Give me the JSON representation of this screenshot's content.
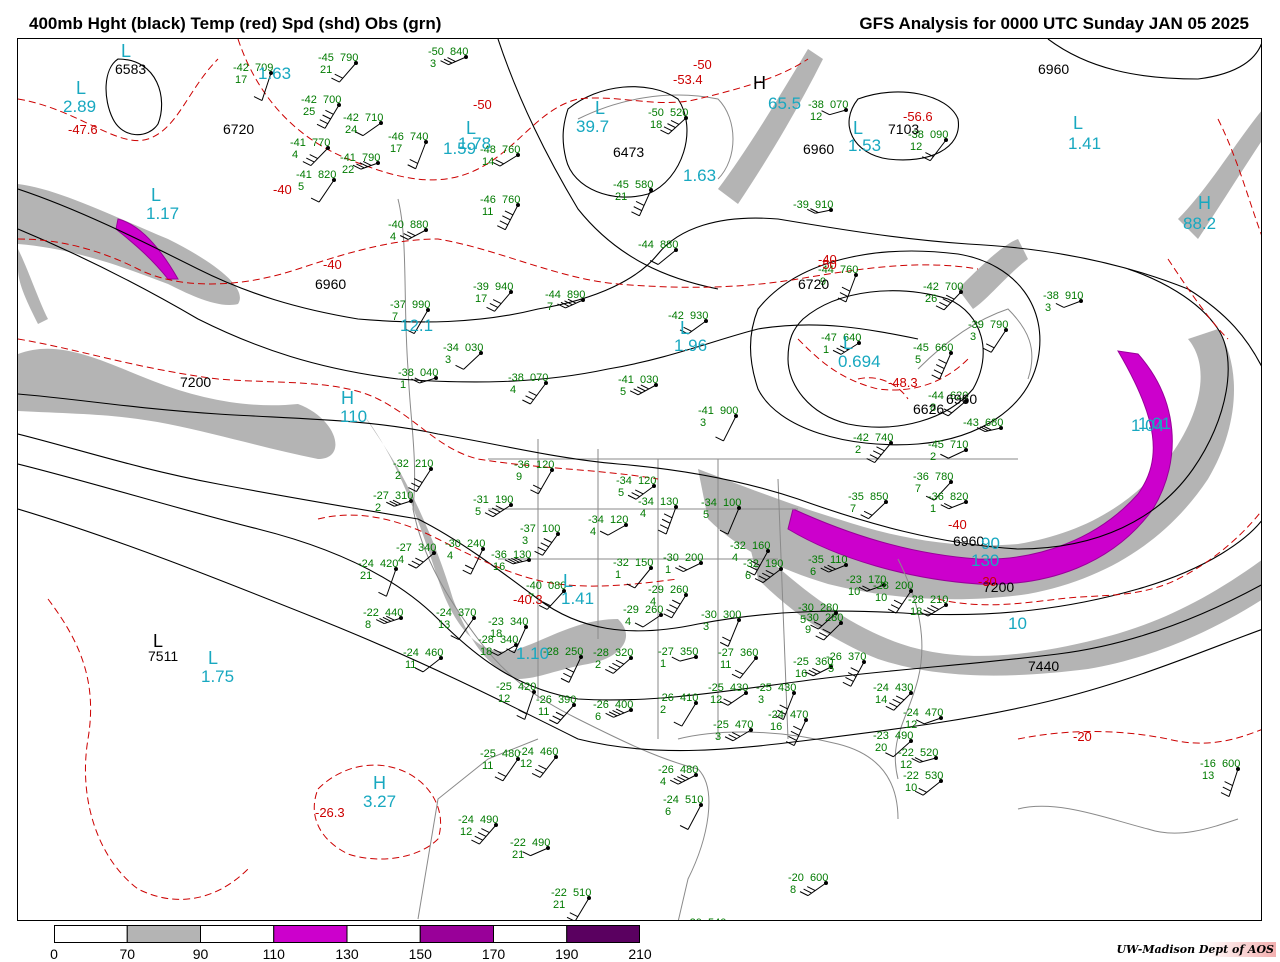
{
  "header": {
    "title_left": "400mb Hght (black) Temp (red) Spd (shd) Obs (grn)",
    "title_right": "GFS Analysis for 0000 UTC Sunday  JAN 05 2025"
  },
  "credit": "UW-Madison  Dept of AOS",
  "colors": {
    "height": "#000000",
    "temp": "#cc0000",
    "obs": "#007a00",
    "speed_label": "#18a8c0",
    "borders": "#8a8a8a"
  },
  "legend": {
    "ticks": [
      "0",
      "70",
      "90",
      "110",
      "130",
      "150",
      "170",
      "190",
      "210"
    ],
    "bins": [
      {
        "from": 0,
        "to": 70,
        "color": "#ffffff"
      },
      {
        "from": 70,
        "to": 90,
        "color": "#b4b4b4"
      },
      {
        "from": 90,
        "to": 110,
        "color": "#ffffff"
      },
      {
        "from": 110,
        "to": 130,
        "color": "#cc00cc"
      },
      {
        "from": 130,
        "to": 150,
        "color": "#ffffff"
      },
      {
        "from": 150,
        "to": 170,
        "color": "#990099"
      },
      {
        "from": 170,
        "to": 190,
        "color": "#ffffff"
      },
      {
        "from": 190,
        "to": 210,
        "color": "#5a0060"
      }
    ]
  },
  "height_labels": [
    "6583",
    "6720",
    "6960",
    "6473",
    "6960",
    "6960",
    "6720",
    "6960",
    "7103",
    "7200",
    "6626",
    "6960",
    "7200",
    "7440",
    "7511"
  ],
  "temp_labels": [
    "-47.6",
    "-50",
    "-50",
    "-53.4",
    "-40",
    "-40",
    "-50",
    "-56.6",
    "-40",
    "-48.3",
    "-40",
    "-40.3",
    "-30",
    "-20",
    "-26.3"
  ],
  "speed_labels": [
    "2.89",
    "1.63",
    "1.17",
    "39.7",
    "1.78",
    "65.5",
    "1.53",
    "1.41",
    "88.2",
    "1.96",
    "0.694",
    "110",
    "1.41",
    "1.75",
    "3.27",
    "1.10",
    "10",
    "130",
    "1.63",
    "90",
    "1.01",
    "12.1",
    "1.59",
    "1.04"
  ],
  "highs_lows": [
    "L",
    "L",
    "L",
    "L",
    "L",
    "H",
    "L",
    "L",
    "H",
    "L",
    "L",
    "H",
    "L",
    "L",
    "H",
    "L"
  ],
  "obs": [
    [
      "-42",
      "709",
      "17"
    ],
    [
      "-45",
      "790",
      "21"
    ],
    [
      "-50",
      "840",
      "3"
    ],
    [
      "-42",
      "700",
      "25"
    ],
    [
      "-42",
      "710",
      "24"
    ],
    [
      "-46",
      "740",
      "17"
    ],
    [
      "-41",
      "770",
      "4"
    ],
    [
      "-41",
      "790",
      "22"
    ],
    [
      "-41",
      "820",
      "5"
    ],
    [
      "-48",
      "760",
      "14"
    ],
    [
      "-45",
      "580",
      "21"
    ],
    [
      "-50",
      "520",
      "18"
    ],
    [
      "-38",
      "070",
      "12"
    ],
    [
      "-38",
      "090",
      "12"
    ],
    [
      "-40",
      "880",
      "4"
    ],
    [
      "-46",
      "760",
      "11"
    ],
    [
      "-44",
      "880",
      ""
    ],
    [
      "-39",
      "910",
      ""
    ],
    [
      "-39",
      "940",
      "17"
    ],
    [
      "-44",
      "890",
      "7"
    ],
    [
      "-37",
      "990",
      "7"
    ],
    [
      "-42",
      "930",
      ""
    ],
    [
      "-44",
      "760",
      "9"
    ],
    [
      "-42",
      "700",
      "26"
    ],
    [
      "-38",
      "910",
      "3"
    ],
    [
      "-39",
      "790",
      "3"
    ],
    [
      "-47",
      "640",
      "1"
    ],
    [
      "-45",
      "660",
      "5"
    ],
    [
      "-34",
      "030",
      "3"
    ],
    [
      "-38",
      "040",
      "1"
    ],
    [
      "-38",
      "070",
      "4"
    ],
    [
      "-41",
      "030",
      "5"
    ],
    [
      "-41",
      "900",
      "3"
    ],
    [
      "-44",
      "620",
      "8"
    ],
    [
      "-43",
      "680",
      ""
    ],
    [
      "-42",
      "740",
      "2"
    ],
    [
      "-45",
      "710",
      "2"
    ],
    [
      "-36",
      "120",
      "9"
    ],
    [
      "-34",
      "120",
      "5"
    ],
    [
      "-34",
      "130",
      "4"
    ],
    [
      "-36",
      "780",
      "7"
    ],
    [
      "-36",
      "820",
      "1"
    ],
    [
      "-32",
      "210",
      "2"
    ],
    [
      "-31",
      "190",
      "5"
    ],
    [
      "-34",
      "100",
      "5"
    ],
    [
      "-35",
      "850",
      "7"
    ],
    [
      "-27",
      "310",
      "2"
    ],
    [
      "-37",
      "100",
      "3"
    ],
    [
      "-34",
      "120",
      "4"
    ],
    [
      "-30",
      "240",
      "4"
    ],
    [
      "-27",
      "340",
      "4"
    ],
    [
      "-36",
      "130",
      "16"
    ],
    [
      "-32",
      "150",
      "1"
    ],
    [
      "-30",
      "200",
      "1"
    ],
    [
      "-32",
      "160",
      "4"
    ],
    [
      "-32",
      "190",
      "6"
    ],
    [
      "-24",
      "420",
      "21"
    ],
    [
      "-40",
      "080",
      "7"
    ],
    [
      "-35",
      "110",
      "6"
    ],
    [
      "-29",
      "260",
      "4"
    ],
    [
      "-29",
      "260",
      "4"
    ],
    [
      "-30",
      "300",
      "3"
    ],
    [
      "-30",
      "280",
      "9"
    ],
    [
      "-22",
      "440",
      "8"
    ],
    [
      "-24",
      "370",
      "13"
    ],
    [
      "-28",
      "340",
      "18"
    ],
    [
      "-28",
      "250",
      ""
    ],
    [
      "-28",
      "320",
      "2"
    ],
    [
      "-27",
      "350",
      "1"
    ],
    [
      "-27",
      "360",
      "11"
    ],
    [
      "-25",
      "360",
      "16"
    ],
    [
      "-26",
      "370",
      "5"
    ],
    [
      "-24",
      "460",
      "11"
    ],
    [
      "-25",
      "420",
      "12"
    ],
    [
      "-26",
      "390",
      "11"
    ],
    [
      "-26",
      "400",
      "6"
    ],
    [
      "-26",
      "410",
      "2"
    ],
    [
      "-25",
      "430",
      "12"
    ],
    [
      "-25",
      "430",
      "3"
    ],
    [
      "-24",
      "430",
      "14"
    ],
    [
      "-24",
      "470",
      "12"
    ],
    [
      "-25",
      "480",
      "11"
    ],
    [
      "-25",
      "470",
      "3"
    ],
    [
      "-24",
      "470",
      "16"
    ],
    [
      "-23",
      "490",
      "20"
    ],
    [
      "-22",
      "520",
      "12"
    ],
    [
      "-24",
      "460",
      "12"
    ],
    [
      "-26",
      "480",
      "4"
    ],
    [
      "-24",
      "510",
      "6"
    ],
    [
      "-22",
      "530",
      "10"
    ],
    [
      "-16",
      "600",
      "13"
    ],
    [
      "-24",
      "490",
      "12"
    ],
    [
      "-22",
      "490",
      "21"
    ],
    [
      "-22",
      "510",
      "21"
    ],
    [
      "-20",
      "600",
      "8"
    ],
    [
      "-20",
      "540",
      ""
    ],
    [
      "-22",
      "530",
      ""
    ],
    [
      "-23",
      "170",
      "10"
    ],
    [
      "-28",
      "200",
      "10"
    ],
    [
      "-28",
      "210",
      "18"
    ],
    [
      "-23",
      "340",
      "18"
    ],
    [
      "-30",
      "280",
      "5"
    ]
  ]
}
